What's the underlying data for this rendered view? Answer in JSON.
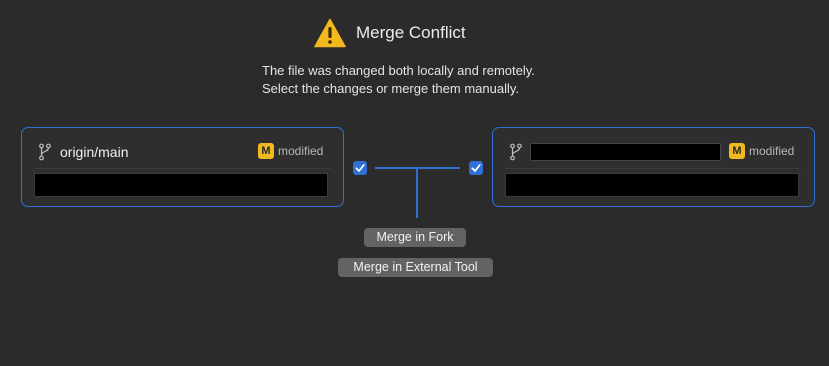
{
  "dialog": {
    "title": "Merge Conflict",
    "description_line1": "The file was changed both locally and remotely.",
    "description_line2": "Select the changes or merge them manually."
  },
  "left_panel": {
    "branch": "origin/main",
    "badge": "M",
    "status": "modified",
    "selected": true
  },
  "right_panel": {
    "branch": "",
    "badge": "M",
    "status": "modified",
    "selected": true
  },
  "buttons": {
    "merge_in_fork": "Merge in Fork",
    "merge_in_external_tool": "Merge in External Tool"
  },
  "colors": {
    "background": "#2b2b2b",
    "accent": "#2f6fd6",
    "warning": "#f1b91d",
    "button": "#636363"
  },
  "icons": [
    "warning-icon",
    "branch-icon",
    "checkmark-icon"
  ]
}
